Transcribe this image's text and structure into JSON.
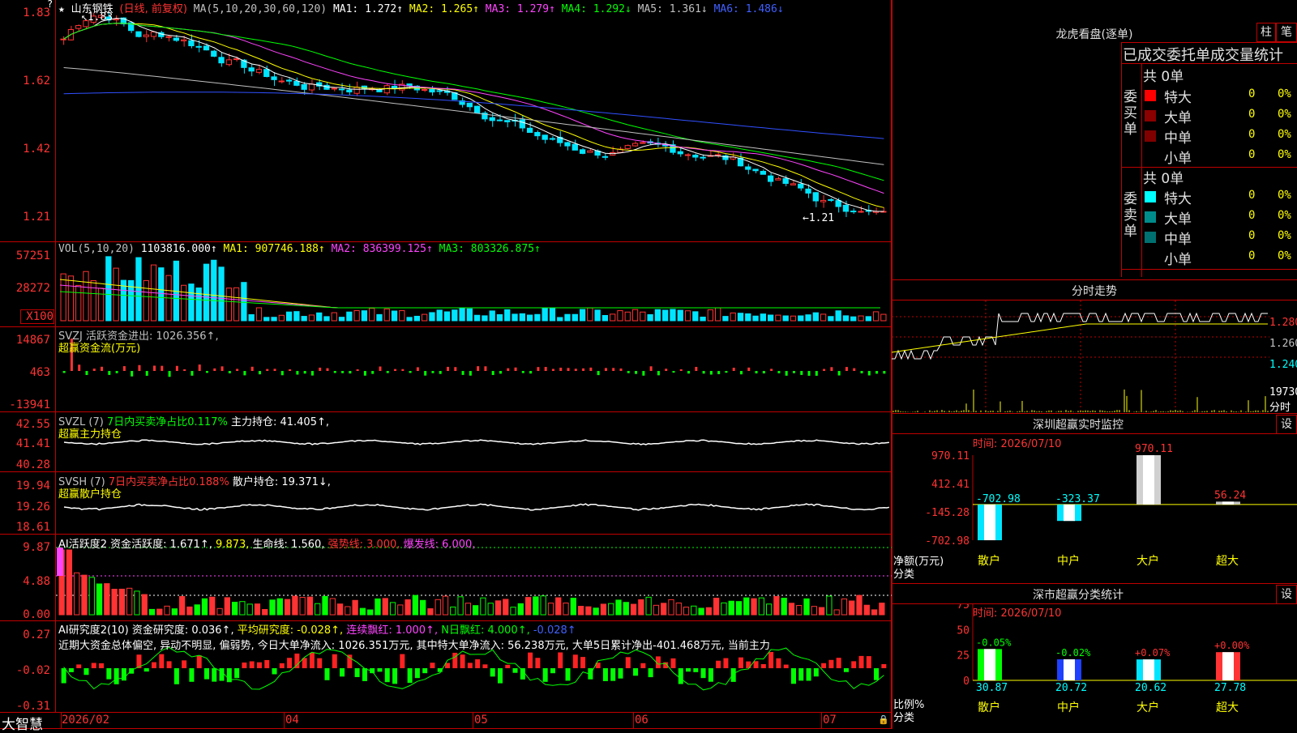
{
  "app": {
    "name": "大智慧"
  },
  "stock": {
    "name": "山东钢铁",
    "period": "(日线, 前复权)"
  },
  "main": {
    "y_ticks": [
      "1.83",
      "1.62",
      "1.42",
      "1.21"
    ],
    "ma_header": "MA(5,10,20,30,60,120)",
    "ma1": "MA1: 1.272↑",
    "ma2": "MA2: 1.265↑",
    "ma3": "MA3: 1.279↑",
    "ma4": "MA4: 1.292↓",
    "ma5": "MA5: 1.361↓",
    "ma6": "MA6: 1.486↓",
    "high_mark": "1.83",
    "low_mark": "←1.21"
  },
  "vol": {
    "y_ticks": [
      "57251",
      "28272",
      "X100"
    ],
    "header": "VOL(5,10,20)",
    "value": "1103816.000↑",
    "ma1": "MA1: 907746.188↑",
    "ma2": "MA2: 836399.125↑",
    "ma3": "MA3: 803326.875↑"
  },
  "svzj": {
    "y_ticks": [
      "14867",
      "463",
      "-13941"
    ],
    "header": "SVZJ  活跃资金进出: 1026.356↑,",
    "sub": "超赢资金流(万元)"
  },
  "svzl": {
    "y_ticks": [
      "42.55",
      "41.41",
      "40.28"
    ],
    "header": "SVZL (7)",
    "ratio": "7日内买卖净占比0.117%",
    "hold": "主力持仓: 41.405↑,",
    "sub": "超赢主力持仓"
  },
  "svsh": {
    "y_ticks": [
      "19.94",
      "19.26",
      "18.61"
    ],
    "header": "SVSH (7)",
    "ratio": "7日内买卖净占比0.188%",
    "hold": "散户持仓: 19.371↓,",
    "sub": "超赢散户持仓"
  },
  "ai_active": {
    "y_ticks": [
      "9.87",
      "4.88",
      "0.00"
    ],
    "header": "AI活跃度2",
    "a": "资金活跃度: 1.671↑,",
    "b": "9.873,",
    "c": "生命线: 1.560,",
    "d": "强势线: 3.000,",
    "e": "爆发线: 6.000,"
  },
  "ai_research": {
    "y_ticks": [
      "0.27",
      "-0.02",
      "-0.31"
    ],
    "header": "AI研究度2(10)",
    "a": "资金研究度: 0.036↑,",
    "b": "平均研究度: -0.028↑,",
    "c": "连续飘红: 1.000↑,",
    "d": "N日飘红: 4.000↑,",
    "e": "-0.028↑",
    "note": "近期大资金总体偏空, 异动不明显, 偏弱势, 今日大单净流入: 1026.351万元, 其中特大单净流入: 56.238万元, 大单5日累计净出-401.468万元, 当前主力"
  },
  "x_axis": [
    "2026/02",
    "04",
    "05",
    "06",
    "07"
  ],
  "dragon": {
    "title": "龙虎看盘(逐单)",
    "btn_bar": "柱",
    "btn_pen": "笔",
    "header": "已成交委托单成交量统计",
    "buy_label": "委买单",
    "sell_label": "委卖单",
    "buy_total": "共 0单",
    "sell_total": "共 0单",
    "buy_rows": [
      {
        "name": "特大",
        "count": "0",
        "pct": "0%",
        "color": "#ff0000"
      },
      {
        "name": "大单",
        "count": "0",
        "pct": "0%",
        "color": "#8b0000"
      },
      {
        "name": "中单",
        "count": "0",
        "pct": "0%",
        "color": "#800000"
      },
      {
        "name": "小单",
        "count": "0",
        "pct": "0%",
        "color": "#000000"
      }
    ],
    "sell_rows": [
      {
        "name": "特大",
        "count": "0",
        "pct": "0%",
        "color": "#00ffff"
      },
      {
        "name": "大单",
        "count": "0",
        "pct": "0%",
        "color": "#008b8b"
      },
      {
        "name": "中单",
        "count": "0",
        "pct": "0%",
        "color": "#007070"
      },
      {
        "name": "小单",
        "count": "0",
        "pct": "0%",
        "color": "#000000"
      }
    ]
  },
  "intraday": {
    "title": "分时走势",
    "ticks": [
      "1.280",
      "1.260",
      "1.240"
    ],
    "vol_label": "19730",
    "vol_unit": "分时"
  },
  "monitor": {
    "title": "深圳超赢实时监控",
    "btn": "设",
    "time": "时间: 2026/07/10",
    "y_ticks": [
      "970.11",
      "412.41",
      "-145.28",
      "-702.98"
    ],
    "axis_label": "净额(万元)",
    "cat_label": "分类",
    "categories": [
      "散户",
      "中户",
      "大户",
      "超大"
    ],
    "values": [
      -702.98,
      -323.37,
      970.11,
      56.24
    ],
    "value_labels": [
      "-702.98",
      "-323.37",
      "970.11",
      "56.24"
    ],
    "ylim": [
      -702.98,
      970.11
    ]
  },
  "classify": {
    "title": "深市超赢分类统计",
    "btn": "设",
    "time": "时间: 2026/07/10",
    "y_ticks": [
      "75",
      "50",
      "25",
      "0"
    ],
    "axis_label": "比例%",
    "cat_label": "分类",
    "categories": [
      "散户",
      "中户",
      "大户",
      "超大"
    ],
    "values": [
      30.87,
      20.72,
      20.62,
      27.78
    ],
    "value_labels": [
      "30.87",
      "20.72",
      "20.62",
      "27.78"
    ],
    "change_labels": [
      "-0.05%",
      "-0.02%",
      "+0.07%",
      "+0.00%"
    ],
    "ylim": [
      0,
      75
    ]
  },
  "chart_data": [
    {
      "type": "bar",
      "title": "深圳超赢实时监控",
      "ylabel": "净额(万元)",
      "categories": [
        "散户",
        "中户",
        "大户",
        "超大"
      ],
      "values": [
        -702.98,
        -323.37,
        970.11,
        56.24
      ],
      "ylim": [
        -702.98,
        970.11
      ]
    },
    {
      "type": "bar",
      "title": "深市超赢分类统计",
      "ylabel": "比例%",
      "categories": [
        "散户",
        "中户",
        "大户",
        "超大"
      ],
      "values": [
        30.87,
        20.72,
        20.62,
        27.78
      ],
      "ylim": [
        0,
        75
      ]
    }
  ]
}
